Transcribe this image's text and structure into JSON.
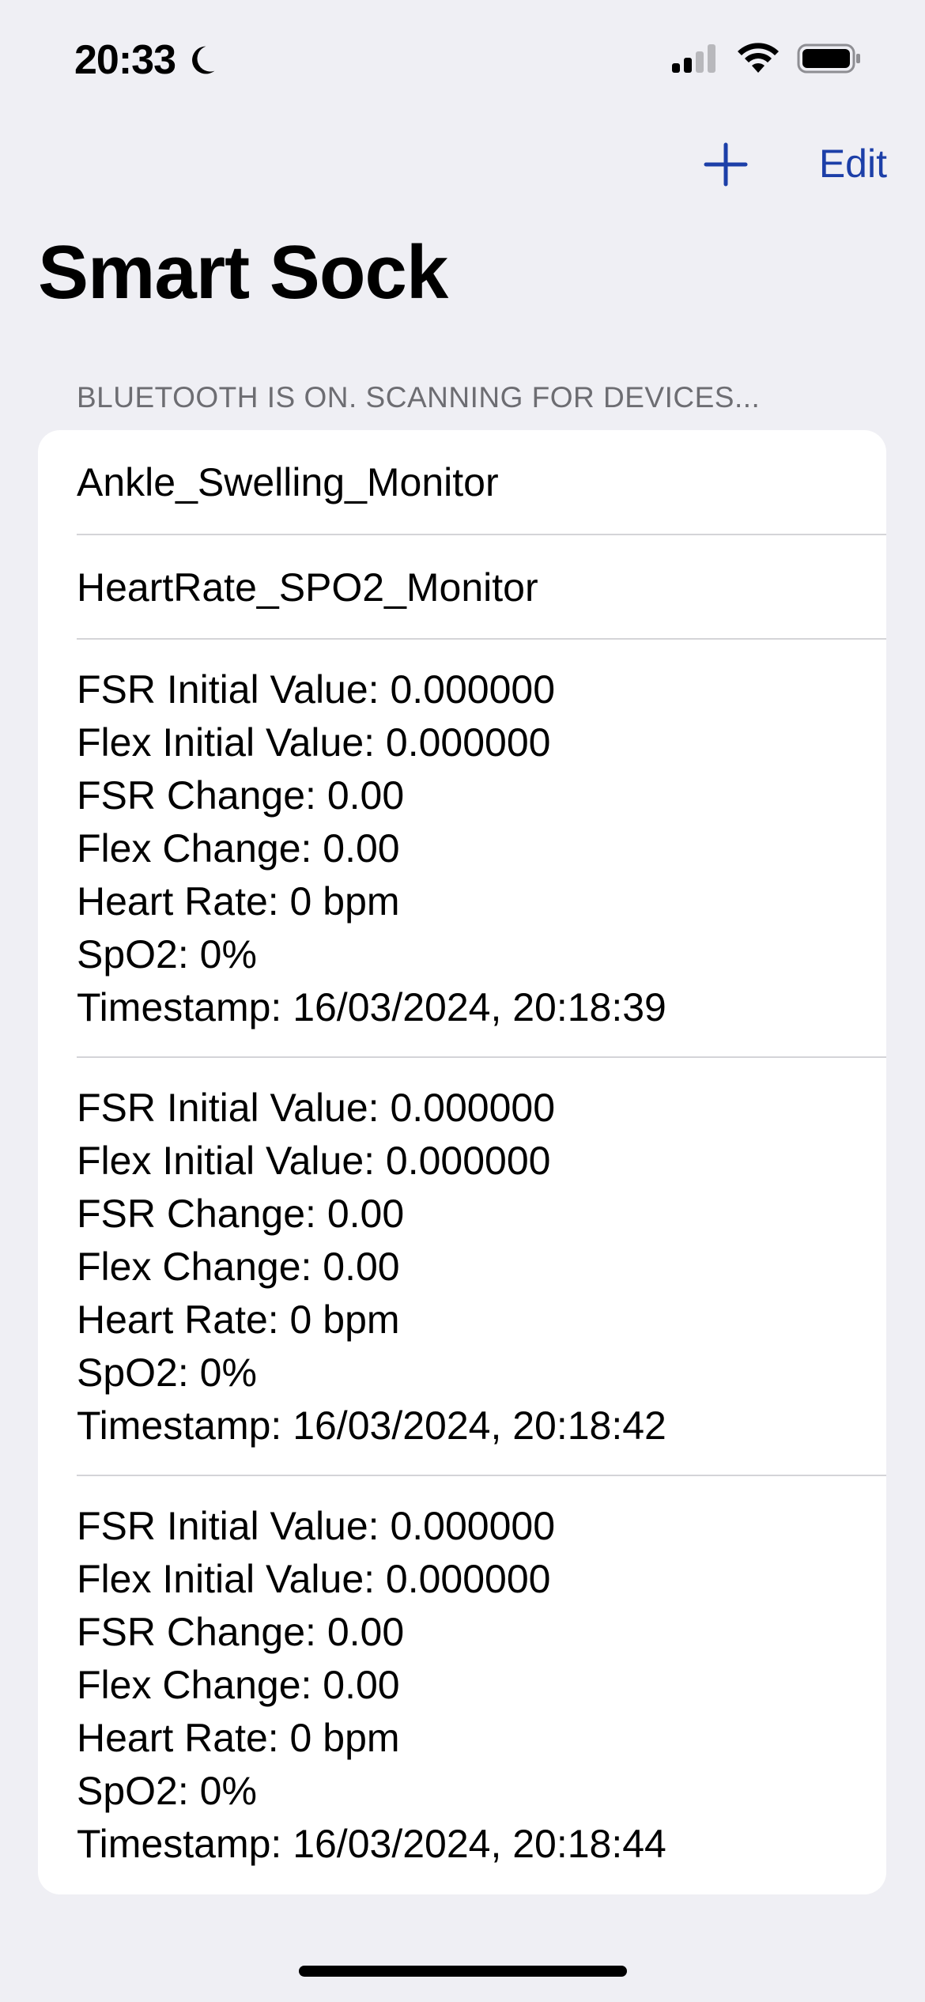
{
  "status_bar": {
    "time": "20:33"
  },
  "nav": {
    "edit_label": "Edit"
  },
  "title": "Smart Sock",
  "section_header": "BLUETOOTH IS ON. SCANNING FOR DEVICES...",
  "devices": [
    {
      "name": "Ankle_Swelling_Monitor"
    },
    {
      "name": "HeartRate_SPO2_Monitor"
    }
  ],
  "readings": [
    {
      "fsr_initial": "FSR Initial Value: 0.000000",
      "flex_initial": "Flex Initial Value: 0.000000",
      "fsr_change": "FSR Change: 0.00",
      "flex_change": "Flex Change: 0.00",
      "heart_rate": "Heart Rate: 0 bpm",
      "spo2": "SpO2: 0%",
      "timestamp": "Timestamp: 16/03/2024, 20:18:39"
    },
    {
      "fsr_initial": "FSR Initial Value: 0.000000",
      "flex_initial": "Flex Initial Value: 0.000000",
      "fsr_change": "FSR Change: 0.00",
      "flex_change": "Flex Change: 0.00",
      "heart_rate": "Heart Rate: 0 bpm",
      "spo2": "SpO2: 0%",
      "timestamp": "Timestamp: 16/03/2024, 20:18:42"
    },
    {
      "fsr_initial": "FSR Initial Value: 0.000000",
      "flex_initial": "Flex Initial Value: 0.000000",
      "fsr_change": "FSR Change: 0.00",
      "flex_change": "Flex Change: 0.00",
      "heart_rate": "Heart Rate: 0 bpm",
      "spo2": "SpO2: 0%",
      "timestamp": "Timestamp: 16/03/2024, 20:18:44"
    }
  ],
  "icons": {
    "moon": "moon-icon",
    "signal": "cellular-signal-icon",
    "wifi": "wifi-icon",
    "battery": "battery-icon",
    "add": "plus-icon"
  },
  "colors": {
    "accent": "#1c3fa8",
    "background": "#efeff4",
    "card": "#ffffff",
    "secondary_text": "#6d6d72"
  }
}
